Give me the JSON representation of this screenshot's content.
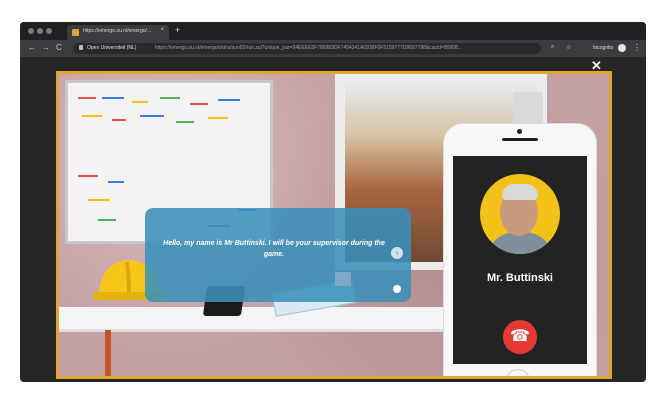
{
  "browser": {
    "tab_title": "https://emergo.ou.nl/emergo/...",
    "tab_close": "×",
    "new_tab": "+",
    "security_label": "Open Universiteit (NL)",
    "url": "https://emergo.ou.nl/emergo/skins/sun02/run.zul?unique_par=94EEEE5F786983DF7454341A0938F0F5159777D8687788&cacid=80908...",
    "incognito_label": "Incognito",
    "nav": {
      "back": "←",
      "forward": "→",
      "reload": "C"
    },
    "search_icon_glyph": "⌕",
    "star_icon_glyph": "☆",
    "menu_glyph": "⋮"
  },
  "game": {
    "close_glyph": "✕",
    "dialog_text": "Hello, my name is Mr Buttinski. I will be your supervisor during the game.",
    "next_glyph": "›",
    "caller_name": "Mr. Buttinski",
    "hangup_glyph": "☎"
  },
  "colors": {
    "frame_border": "#e3a430",
    "dialog_bg": "#3a8fba",
    "avatar_bg": "#f3c11a",
    "hangup": "#e53935"
  },
  "icons": [
    "tab-favicon-icon",
    "close-icon",
    "next-arrow-icon",
    "replay-icon",
    "hangup-phone-icon",
    "lock-icon",
    "search-icon",
    "star-icon",
    "incognito-icon",
    "menu-icon"
  ]
}
